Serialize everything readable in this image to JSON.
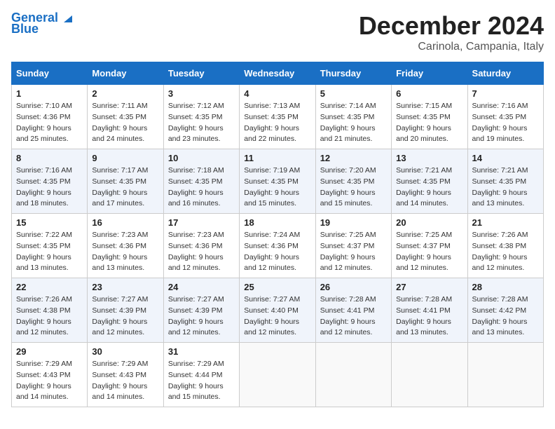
{
  "header": {
    "logo_line1": "General",
    "logo_line2": "Blue",
    "month": "December 2024",
    "location": "Carinola, Campania, Italy"
  },
  "days_of_week": [
    "Sunday",
    "Monday",
    "Tuesday",
    "Wednesday",
    "Thursday",
    "Friday",
    "Saturday"
  ],
  "weeks": [
    [
      {
        "day": "1",
        "sunrise": "7:10 AM",
        "sunset": "4:36 PM",
        "daylight": "9 hours and 25 minutes."
      },
      {
        "day": "2",
        "sunrise": "7:11 AM",
        "sunset": "4:35 PM",
        "daylight": "9 hours and 24 minutes."
      },
      {
        "day": "3",
        "sunrise": "7:12 AM",
        "sunset": "4:35 PM",
        "daylight": "9 hours and 23 minutes."
      },
      {
        "day": "4",
        "sunrise": "7:13 AM",
        "sunset": "4:35 PM",
        "daylight": "9 hours and 22 minutes."
      },
      {
        "day": "5",
        "sunrise": "7:14 AM",
        "sunset": "4:35 PM",
        "daylight": "9 hours and 21 minutes."
      },
      {
        "day": "6",
        "sunrise": "7:15 AM",
        "sunset": "4:35 PM",
        "daylight": "9 hours and 20 minutes."
      },
      {
        "day": "7",
        "sunrise": "7:16 AM",
        "sunset": "4:35 PM",
        "daylight": "9 hours and 19 minutes."
      }
    ],
    [
      {
        "day": "8",
        "sunrise": "7:16 AM",
        "sunset": "4:35 PM",
        "daylight": "9 hours and 18 minutes."
      },
      {
        "day": "9",
        "sunrise": "7:17 AM",
        "sunset": "4:35 PM",
        "daylight": "9 hours and 17 minutes."
      },
      {
        "day": "10",
        "sunrise": "7:18 AM",
        "sunset": "4:35 PM",
        "daylight": "9 hours and 16 minutes."
      },
      {
        "day": "11",
        "sunrise": "7:19 AM",
        "sunset": "4:35 PM",
        "daylight": "9 hours and 15 minutes."
      },
      {
        "day": "12",
        "sunrise": "7:20 AM",
        "sunset": "4:35 PM",
        "daylight": "9 hours and 15 minutes."
      },
      {
        "day": "13",
        "sunrise": "7:21 AM",
        "sunset": "4:35 PM",
        "daylight": "9 hours and 14 minutes."
      },
      {
        "day": "14",
        "sunrise": "7:21 AM",
        "sunset": "4:35 PM",
        "daylight": "9 hours and 13 minutes."
      }
    ],
    [
      {
        "day": "15",
        "sunrise": "7:22 AM",
        "sunset": "4:35 PM",
        "daylight": "9 hours and 13 minutes."
      },
      {
        "day": "16",
        "sunrise": "7:23 AM",
        "sunset": "4:36 PM",
        "daylight": "9 hours and 13 minutes."
      },
      {
        "day": "17",
        "sunrise": "7:23 AM",
        "sunset": "4:36 PM",
        "daylight": "9 hours and 12 minutes."
      },
      {
        "day": "18",
        "sunrise": "7:24 AM",
        "sunset": "4:36 PM",
        "daylight": "9 hours and 12 minutes."
      },
      {
        "day": "19",
        "sunrise": "7:25 AM",
        "sunset": "4:37 PM",
        "daylight": "9 hours and 12 minutes."
      },
      {
        "day": "20",
        "sunrise": "7:25 AM",
        "sunset": "4:37 PM",
        "daylight": "9 hours and 12 minutes."
      },
      {
        "day": "21",
        "sunrise": "7:26 AM",
        "sunset": "4:38 PM",
        "daylight": "9 hours and 12 minutes."
      }
    ],
    [
      {
        "day": "22",
        "sunrise": "7:26 AM",
        "sunset": "4:38 PM",
        "daylight": "9 hours and 12 minutes."
      },
      {
        "day": "23",
        "sunrise": "7:27 AM",
        "sunset": "4:39 PM",
        "daylight": "9 hours and 12 minutes."
      },
      {
        "day": "24",
        "sunrise": "7:27 AM",
        "sunset": "4:39 PM",
        "daylight": "9 hours and 12 minutes."
      },
      {
        "day": "25",
        "sunrise": "7:27 AM",
        "sunset": "4:40 PM",
        "daylight": "9 hours and 12 minutes."
      },
      {
        "day": "26",
        "sunrise": "7:28 AM",
        "sunset": "4:41 PM",
        "daylight": "9 hours and 12 minutes."
      },
      {
        "day": "27",
        "sunrise": "7:28 AM",
        "sunset": "4:41 PM",
        "daylight": "9 hours and 13 minutes."
      },
      {
        "day": "28",
        "sunrise": "7:28 AM",
        "sunset": "4:42 PM",
        "daylight": "9 hours and 13 minutes."
      }
    ],
    [
      {
        "day": "29",
        "sunrise": "7:29 AM",
        "sunset": "4:43 PM",
        "daylight": "9 hours and 14 minutes."
      },
      {
        "day": "30",
        "sunrise": "7:29 AM",
        "sunset": "4:43 PM",
        "daylight": "9 hours and 14 minutes."
      },
      {
        "day": "31",
        "sunrise": "7:29 AM",
        "sunset": "4:44 PM",
        "daylight": "9 hours and 15 minutes."
      },
      null,
      null,
      null,
      null
    ]
  ],
  "labels": {
    "sunrise": "Sunrise:",
    "sunset": "Sunset:",
    "daylight": "Daylight:"
  }
}
